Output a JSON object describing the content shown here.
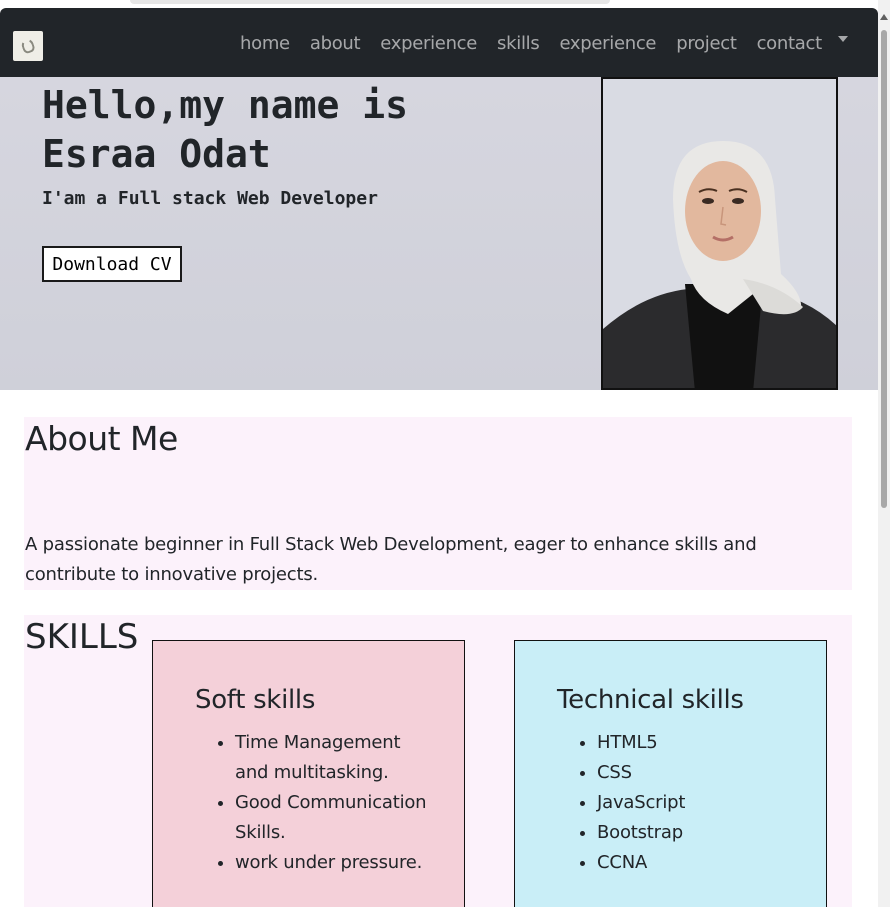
{
  "navbar": {
    "brand_icon": "logo-icon",
    "links": [
      "home",
      "about",
      "experience",
      "skills",
      "experience",
      "project",
      "contact"
    ],
    "dropdown_icon": "caret-down-icon"
  },
  "hero": {
    "title_line1": "Hello,my name is",
    "title_line2": "Esraa Odat",
    "subtitle": "I'am a Full stack Web Developer",
    "cv_button": "Download CV"
  },
  "about": {
    "heading": "About Me",
    "text": "A passionate beginner in Full Stack Web Development, eager to enhance skills and contribute to innovative projects."
  },
  "skills": {
    "heading": "SKILLS",
    "soft": {
      "title": "Soft skills",
      "items": [
        "Time Management and multitasking.",
        "Good Communication Skills.",
        "work under pressure."
      ]
    },
    "technical": {
      "title": "Technical skills",
      "items": [
        "HTML5",
        "CSS",
        "JavaScript",
        "Bootstrap",
        "CCNA"
      ]
    }
  },
  "colors": {
    "navbar": "#212529",
    "hero_bg": "#d4d4dd",
    "section_bg": "#fcf2fb",
    "soft_card": "#f4d0d9",
    "tech_card": "#c9eef7"
  }
}
